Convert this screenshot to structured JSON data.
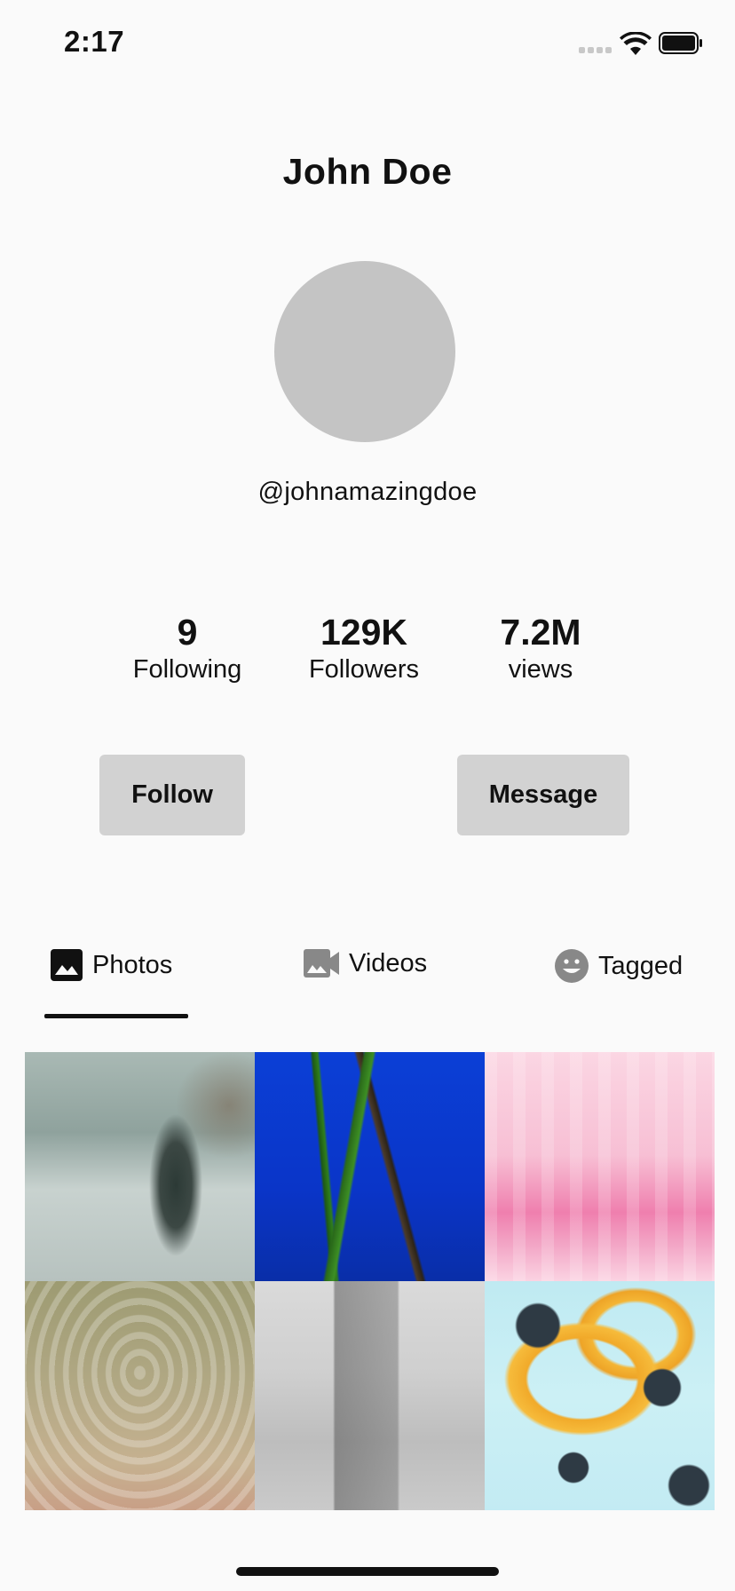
{
  "status_bar": {
    "time": "2:17"
  },
  "profile": {
    "name": "John Doe",
    "handle": "@johnamazingdoe"
  },
  "stats": [
    {
      "value": "9",
      "label": "Following"
    },
    {
      "value": "129K",
      "label": "Followers"
    },
    {
      "value": "7.2M",
      "label": "views"
    }
  ],
  "actions": {
    "follow_label": "Follow",
    "message_label": "Message"
  },
  "tabs": [
    {
      "label": "Photos",
      "icon": "photo-icon",
      "selected": true
    },
    {
      "label": "Videos",
      "icon": "video-camera-icon",
      "selected": false
    },
    {
      "label": "Tagged",
      "icon": "smiley-icon",
      "selected": false
    }
  ],
  "photo_grid": {
    "photos": [
      {
        "subject": "person in snow through rainy window"
      },
      {
        "subject": "seahorse on green seagrass"
      },
      {
        "subject": "pink paint drips"
      },
      {
        "subject": "rippled sandy water"
      },
      {
        "subject": "skyscraper in fog"
      },
      {
        "subject": "yellow paint splash"
      }
    ]
  },
  "colors": {
    "background": "#fafafa",
    "text": "#111111",
    "avatar_placeholder": "#c4c4c4",
    "button_background": "#d2d2d2",
    "inactive_icon": "#888888"
  }
}
